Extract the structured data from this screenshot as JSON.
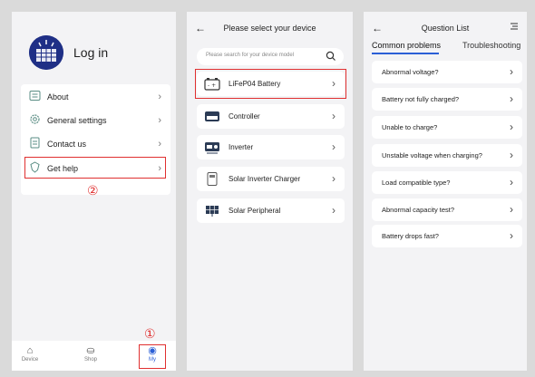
{
  "panel1": {
    "login_label": "Log in",
    "menu_items": [
      {
        "label": "About",
        "icon": "info-card-icon"
      },
      {
        "label": "General settings",
        "icon": "gear-icon"
      },
      {
        "label": "Contact us",
        "icon": "document-icon"
      },
      {
        "label": "Get help",
        "icon": "help-shield-icon"
      }
    ],
    "annotation_2": "②",
    "annotation_1": "①",
    "tabs": [
      {
        "label": "Device",
        "icon": "home-icon"
      },
      {
        "label": "Shop",
        "icon": "shopping-bag-icon"
      },
      {
        "label": "My",
        "icon": "user-icon",
        "active": true
      }
    ]
  },
  "panel2": {
    "title": "Please select your device",
    "search_placeholder": "Please search for your device model",
    "devices": [
      {
        "label": "LiFeP04 Battery",
        "icon": "battery-icon"
      },
      {
        "label": "Controller",
        "icon": "controller-icon"
      },
      {
        "label": "Inverter",
        "icon": "inverter-icon"
      },
      {
        "label": "Solar Inverter Charger",
        "icon": "inverter-charger-icon"
      },
      {
        "label": "Solar Peripheral",
        "icon": "solar-panel-icon"
      }
    ]
  },
  "panel3": {
    "title": "Question List",
    "tabs": [
      "Common problems",
      "Troubleshooting"
    ],
    "questions": [
      "Abnormal voltage?",
      "Battery not fully charged?",
      "Unable to charge?",
      "Unstable voltage when charging?",
      "Load compatible type?",
      "Abnormal capacity test?",
      "Battery drops fast?"
    ]
  },
  "colors": {
    "accent": "#2b5fd6",
    "highlight": "#e03030",
    "icon_teal": "#5a8d84",
    "logo_navy": "#1f2f86"
  }
}
